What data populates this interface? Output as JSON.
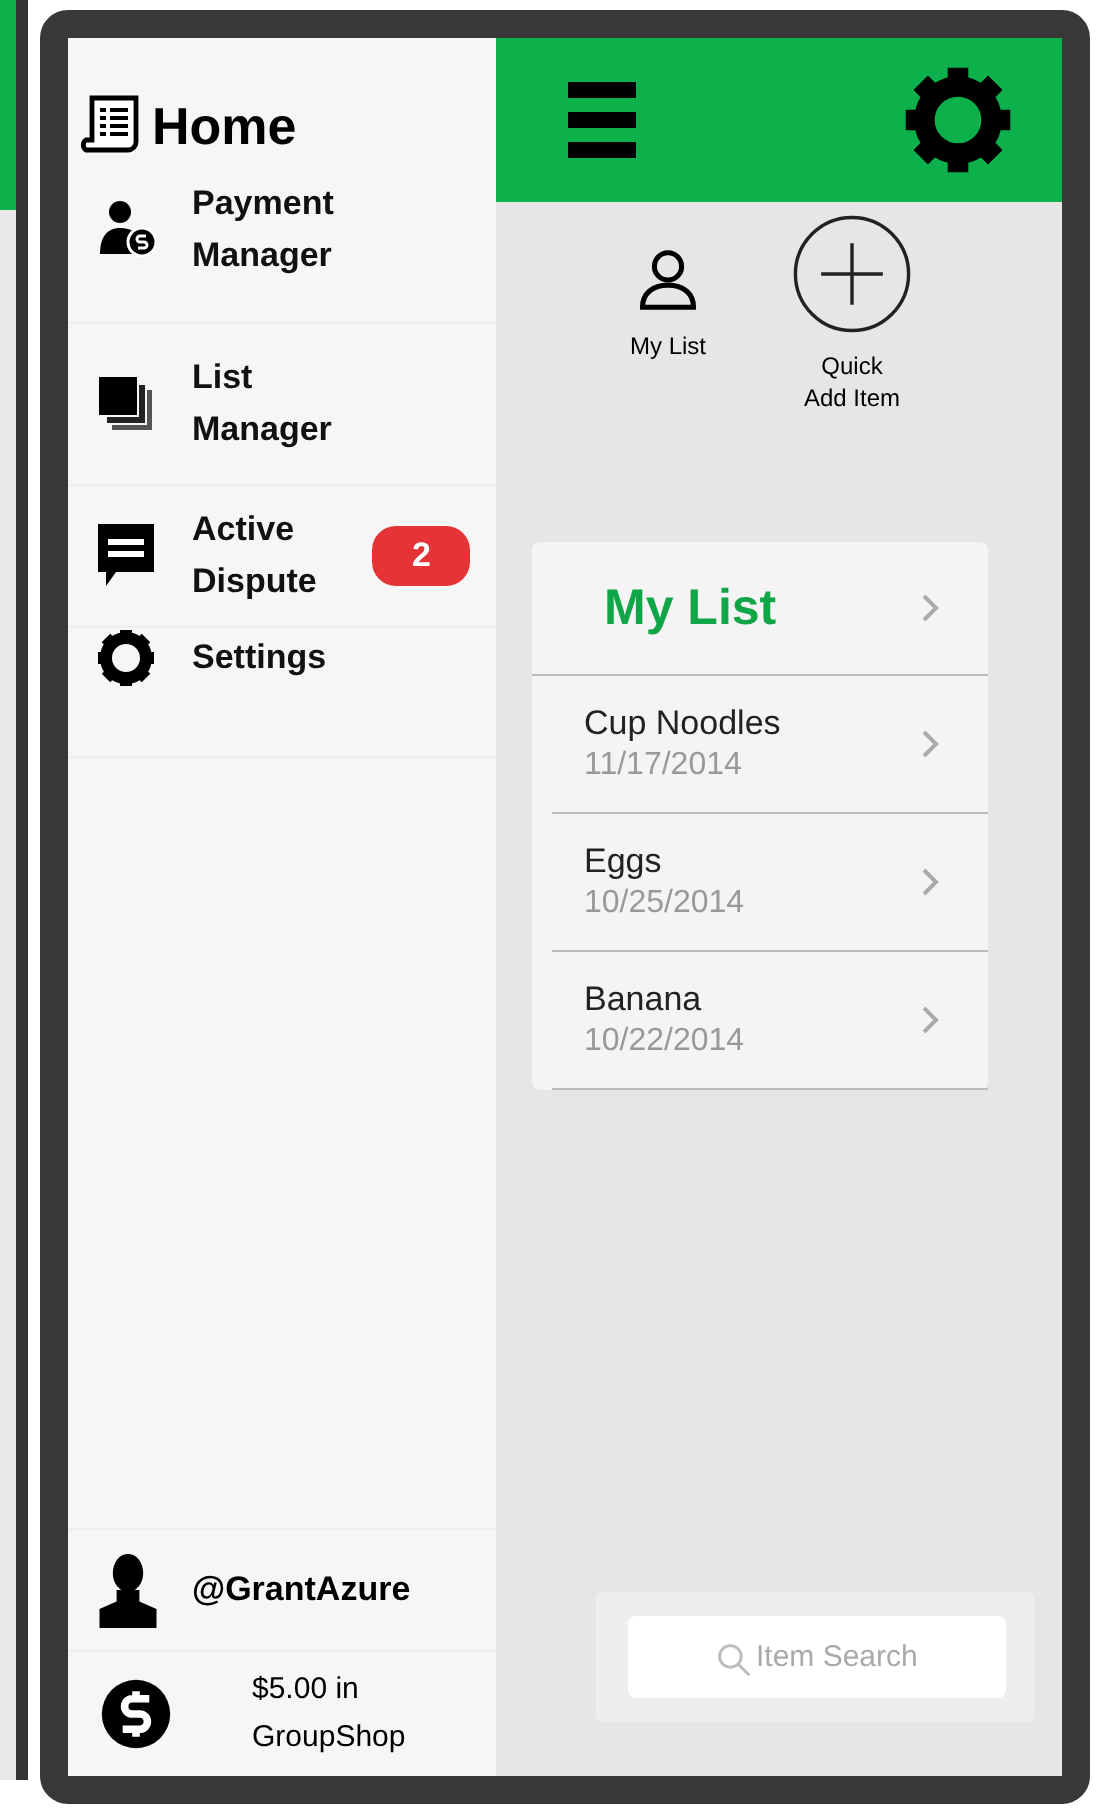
{
  "sidebar": {
    "title": "Home",
    "items": [
      {
        "kind": "payment",
        "label": "Payment Manager"
      },
      {
        "kind": "list",
        "label": "List Manager"
      },
      {
        "kind": "dispute",
        "label": "Active Dispute",
        "badge": "2"
      },
      {
        "kind": "settings",
        "label": "Settings"
      }
    ],
    "user": {
      "handle": "@GrantAzure"
    },
    "balance": {
      "text": "$5.00 in GroupShop"
    }
  },
  "quick_actions": [
    {
      "kind": "user",
      "label": "My List"
    },
    {
      "kind": "add",
      "label": "Quick Add Item"
    }
  ],
  "list_card": {
    "title": "My List",
    "items": [
      {
        "name": "Cup Noodles",
        "date": "11/17/2014"
      },
      {
        "name": "Eggs",
        "date": "10/25/2014"
      },
      {
        "name": "Banana",
        "date": "10/22/2014"
      }
    ]
  },
  "search": {
    "placeholder": "Item Search"
  }
}
